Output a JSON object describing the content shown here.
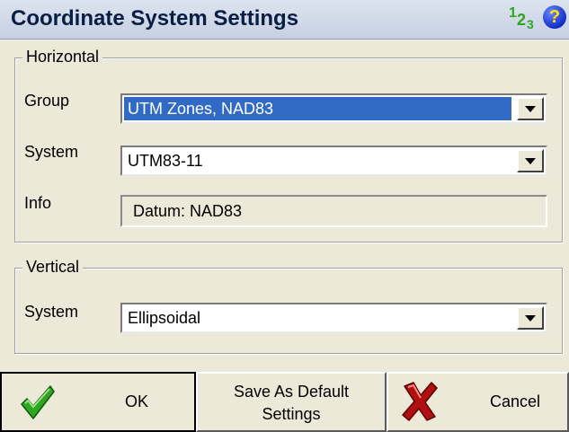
{
  "window": {
    "title": "Coordinate System Settings"
  },
  "header_icons": {
    "numeric_icon": "123",
    "help_icon_glyph": "?"
  },
  "horizontal": {
    "legend": "Horizontal",
    "group_label": "Group",
    "group_value": "UTM Zones, NAD83",
    "system_label": "System",
    "system_value": "UTM83-11",
    "info_label": "Info",
    "info_value": "Datum: NAD83"
  },
  "vertical": {
    "legend": "Vertical",
    "system_label": "System",
    "system_value": "Ellipsoidal"
  },
  "buttons": {
    "ok": "OK",
    "save_default_line1": "Save As Default",
    "save_default_line2": "Settings",
    "cancel": "Cancel"
  },
  "colors": {
    "selection": "#316ac5",
    "check_green": "#2ea61d",
    "cancel_red": "#b01010",
    "help_blue": "#1030c8",
    "help_yellow": "#ffe600"
  },
  "icons": {
    "ok": "checkmark-icon",
    "cancel": "red-x-icon",
    "help": "help-icon",
    "numeric": "numeric-123-icon",
    "dropdown": "chevron-down-icon"
  }
}
